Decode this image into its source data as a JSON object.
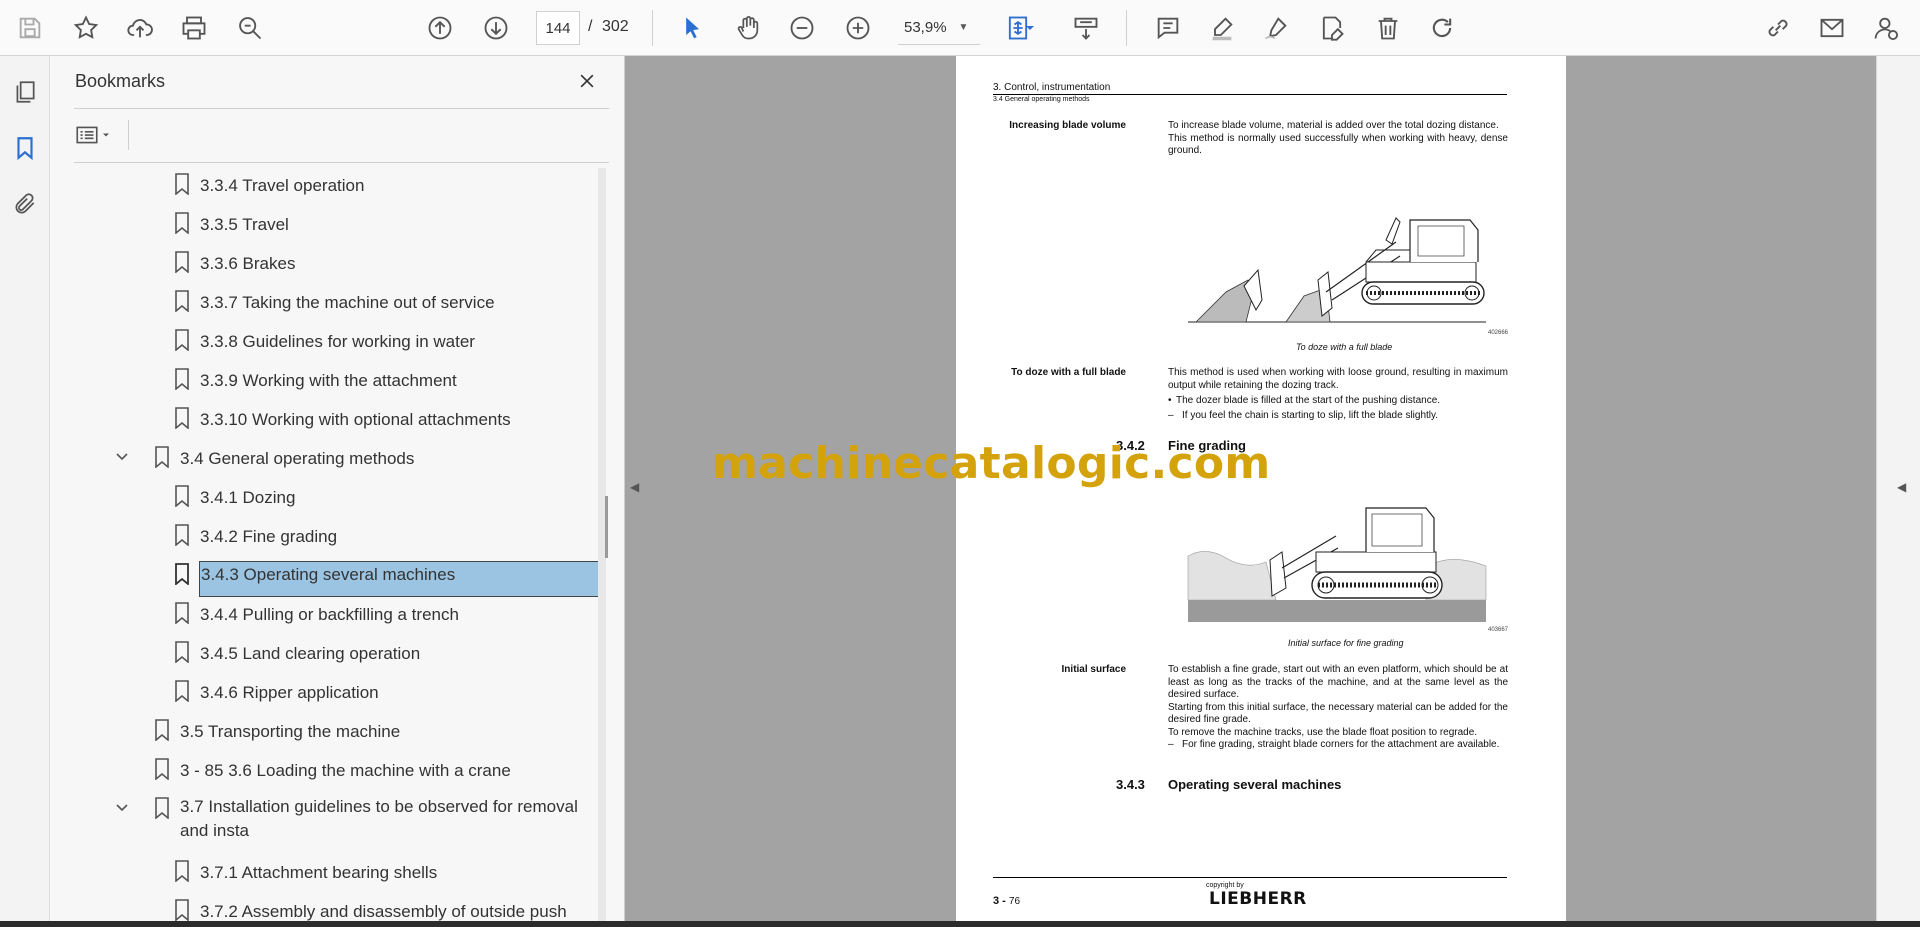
{
  "toolbar": {
    "page_current": "144",
    "page_separator": "/",
    "page_total": "302",
    "zoom": "53,9%"
  },
  "bookmarks_panel": {
    "title": "Bookmarks",
    "items": [
      {
        "label": "3.3.4 Travel operation"
      },
      {
        "label": "3.3.5 Travel"
      },
      {
        "label": "3.3.6 Brakes"
      },
      {
        "label": "3.3.7 Taking the machine out of service"
      },
      {
        "label": "3.3.8 Guidelines for working in water"
      },
      {
        "label": "3.3.9 Working with the attachment"
      },
      {
        "label": "3.3.10 Working with optional attachments"
      },
      {
        "label": "3.4 General operating methods"
      },
      {
        "label": "3.4.1 Dozing"
      },
      {
        "label": "3.4.2 Fine grading"
      },
      {
        "label": "3.4.3 Operating several machines"
      },
      {
        "label": "3.4.4 Pulling or backfilling a trench"
      },
      {
        "label": "3.4.5 Land clearing operation"
      },
      {
        "label": "3.4.6 Ripper application"
      },
      {
        "label": "3.5 Transporting the machine"
      },
      {
        "label": "3 - 85 3.6 Loading the machine with a crane"
      },
      {
        "label": "3.7 Installation guidelines to be observed for removal and insta"
      },
      {
        "label": "3.7.1 Attachment bearing shells"
      },
      {
        "label": "3.7.2 Assembly and disassembly of outside push"
      }
    ]
  },
  "page": {
    "header_chapter": "3. Control, instrumentation",
    "header_section": "3.4 General operating methods",
    "blade_volume": {
      "label": "Increasing blade volume",
      "text1": "To increase blade volume, material is added over the total dozing distance.",
      "text2": "This method is normally used successfully when working with heavy, dense ground."
    },
    "figure1": {
      "number": "402666",
      "caption": "To doze with a full blade"
    },
    "full_blade": {
      "label": "To doze with a full blade",
      "text": "This method is used when working with loose ground, resulting in maximum output while retaining the dozing track.",
      "bullet": "The dozer blade is filled at the start of the pushing distance.",
      "dash": "If you feel the chain is starting to slip, lift the blade slightly."
    },
    "section_342": {
      "number": "3.4.2",
      "title": "Fine grading"
    },
    "figure2": {
      "number": "403667",
      "caption": "Initial surface for fine grading"
    },
    "initial_surface": {
      "label": "Initial surface",
      "text1": "To establish a fine grade, start out with an even platform, which should be at least as long as the tracks of the machine, and at the same level as the desired surface.",
      "text2": "Starting from this initial surface, the necessary material can be added for the desired fine grade.",
      "text3": "To remove the machine tracks, use the blade float position to regrade.",
      "dash": "For fine grading, straight blade corners for the attachment are available."
    },
    "section_343": {
      "number": "3.4.3",
      "title": "Operating several machines"
    },
    "footer": {
      "page_chapter": "3",
      "page_sep": " - ",
      "page_num": "76",
      "copyright": "copyright by",
      "logo": "LIEBHERR"
    }
  },
  "watermark": "machinecatalogic.com",
  "colors": {
    "selected": "#9bc4e2",
    "accent_blue": "#2a6fd1",
    "watermark": "#d4a20a"
  }
}
